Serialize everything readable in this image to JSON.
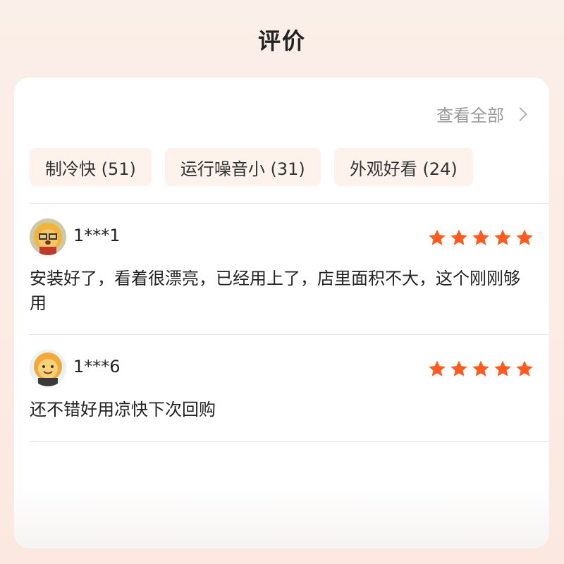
{
  "header": {
    "title": "评价"
  },
  "card": {
    "view_all": "查看全部",
    "tags": [
      "制冷快 (51)",
      "运行噪音小 (31)",
      "外观好看 (24)"
    ],
    "reviews": [
      {
        "user": "1***1",
        "rating": 5,
        "text": "安装好了，看着很漂亮，已经用上了，店里面积不大，这个刚刚够用"
      },
      {
        "user": "1***6",
        "rating": 5,
        "text": "还不错好用凉快下次回购"
      }
    ]
  },
  "colors": {
    "star": "#ff5a1f",
    "tag_bg": "#fdf3ec",
    "muted": "#9a9a9a"
  },
  "icons": {
    "chevron": "chevron-right-icon",
    "star": "star-icon",
    "avatar": "lion-mascot-avatar"
  }
}
